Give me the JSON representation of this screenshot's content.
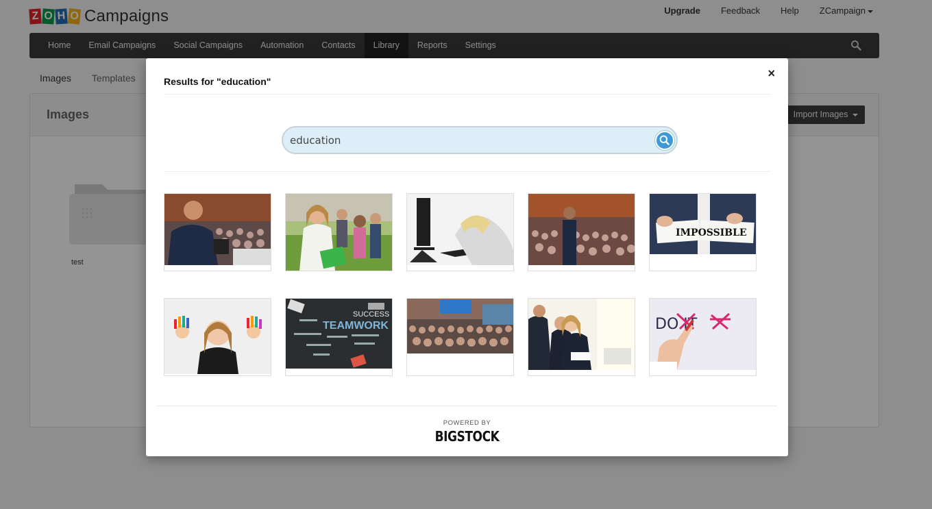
{
  "app": {
    "logo_letters": [
      "Z",
      "O",
      "H",
      "O"
    ],
    "logo_text": "Campaigns"
  },
  "top_links": {
    "upgrade": "Upgrade",
    "feedback": "Feedback",
    "help": "Help",
    "account": "ZCampaign"
  },
  "nav": {
    "items": [
      "Home",
      "Email Campaigns",
      "Social Campaigns",
      "Automation",
      "Contacts",
      "Library",
      "Reports",
      "Settings"
    ],
    "active": "Library",
    "search_icon": "search-icon"
  },
  "subtabs": [
    "Images",
    "Templates"
  ],
  "panel": {
    "title": "Images",
    "import_button": "Import Images",
    "folder_label": "test"
  },
  "modal": {
    "title": "Results for \"education\"",
    "close": "×",
    "search_value": "education",
    "search_icon": "magnifier-icon",
    "images": [
      "speaker-audience",
      "student-girl",
      "tired-at-computer",
      "conference-speaker",
      "impossible-sign",
      "painted-hands-girl",
      "teamwork-words",
      "conference-hall",
      "business-meeting",
      "dont-quit"
    ],
    "image_texts": {
      "impossible": "IMPOSSIBLE",
      "teamwork": "TEAMWORK",
      "success": "SUCCESS",
      "dont_quit": "DO IT"
    },
    "powered_by": "POWERED BY",
    "brand": "BIGSTOCK"
  },
  "colors": {
    "navbar": "#3a3a3a",
    "search_bg": "#ddeef8",
    "search_button": "#3d9ad8"
  }
}
